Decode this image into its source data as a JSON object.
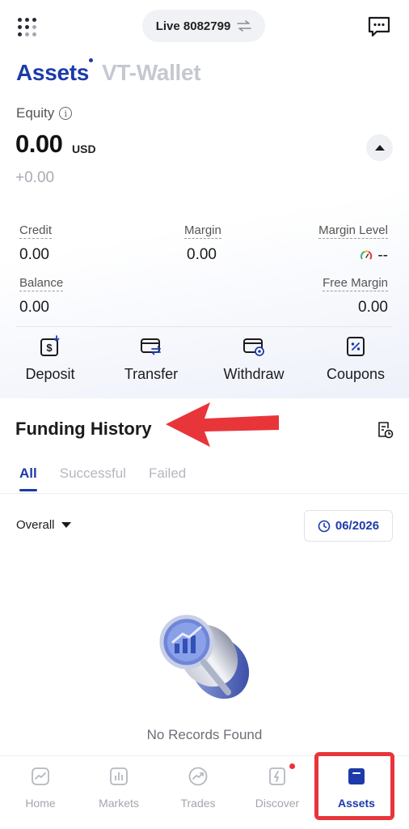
{
  "header": {
    "account": "Live 8082799"
  },
  "wallet_tabs": {
    "assets": "Assets",
    "vt_wallet": "VT-Wallet"
  },
  "equity": {
    "label": "Equity",
    "info_glyph": "i",
    "value": "0.00",
    "unit": "USD",
    "change": "+0.00"
  },
  "stats": {
    "credit": {
      "label": "Credit",
      "value": "0.00"
    },
    "margin": {
      "label": "Margin",
      "value": "0.00"
    },
    "margin_level": {
      "label": "Margin Level",
      "value": "--"
    },
    "balance": {
      "label": "Balance",
      "value": "0.00"
    },
    "free_margin": {
      "label": "Free Margin",
      "value": "0.00"
    }
  },
  "actions": [
    {
      "label": "Deposit",
      "icon": "deposit-icon"
    },
    {
      "label": "Transfer",
      "icon": "transfer-icon"
    },
    {
      "label": "Withdraw",
      "icon": "withdraw-icon"
    },
    {
      "label": "Coupons",
      "icon": "coupon-icon"
    }
  ],
  "funding_history": {
    "title": "Funding History",
    "tabs": [
      "All",
      "Successful",
      "Failed"
    ],
    "active_tab": "All",
    "filter": "Overall",
    "date": "06/2026",
    "empty_text": "No Records Found"
  },
  "bottom_nav": [
    {
      "label": "Home",
      "icon": "home-icon"
    },
    {
      "label": "Markets",
      "icon": "markets-icon"
    },
    {
      "label": "Trades",
      "icon": "trades-icon"
    },
    {
      "label": "Discover",
      "icon": "discover-icon",
      "badge": true
    },
    {
      "label": "Assets",
      "icon": "assets-icon",
      "active": true
    }
  ],
  "colors": {
    "accent": "#1c3aa9",
    "annotation_red": "#e8353a",
    "muted": "#a3a6ae"
  }
}
